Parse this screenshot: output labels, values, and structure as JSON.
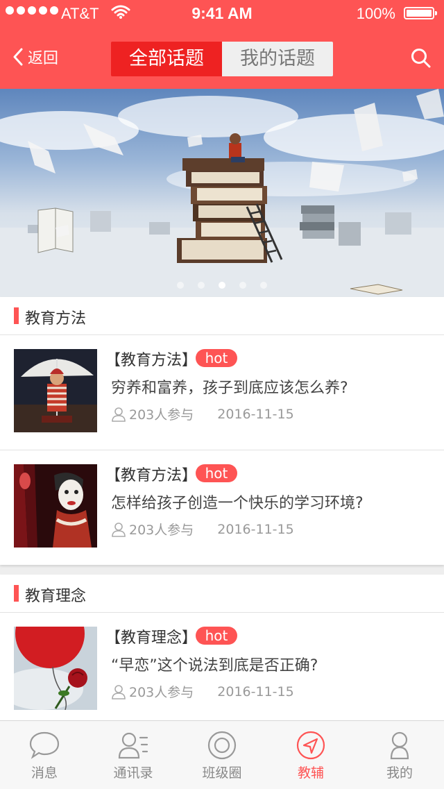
{
  "status_bar": {
    "carrier": "AT&T",
    "time": "9:41 AM",
    "battery": "100%"
  },
  "nav": {
    "back_label": "返回",
    "tabs": [
      {
        "label": "全部话题",
        "active": true
      },
      {
        "label": "我的话题",
        "active": false
      }
    ]
  },
  "banner": {
    "page_count": 5,
    "active_page": 3
  },
  "sections": [
    {
      "title": "教育方法",
      "items": [
        {
          "tag": "【教育方法】",
          "badge": "hot",
          "title": "穷养和富养，孩子到底应该怎么养?",
          "participants": "203人参与",
          "date": "2016-11-15"
        },
        {
          "tag": "【教育方法】",
          "badge": "hot",
          "title": "怎样给孩子创造一个快乐的学习环境?",
          "participants": "203人参与",
          "date": "2016-11-15"
        }
      ]
    },
    {
      "title": "教育理念",
      "items": [
        {
          "tag": "【教育理念】",
          "badge": "hot",
          "title": "“早恋”这个说法到底是否正确?",
          "participants": "203人参与",
          "date": "2016-11-15"
        }
      ]
    }
  ],
  "tabbar": [
    {
      "label": "消息",
      "icon": "chat-bubble-icon",
      "active": false
    },
    {
      "label": "通讯录",
      "icon": "contacts-icon",
      "active": false
    },
    {
      "label": "班级圈",
      "icon": "circle-icon",
      "active": false
    },
    {
      "label": "教辅",
      "icon": "compass-icon",
      "active": true
    },
    {
      "label": "我的",
      "icon": "person-icon",
      "active": false
    }
  ],
  "colors": {
    "primary": "#fe5454",
    "tab_active": "#ee2222"
  }
}
